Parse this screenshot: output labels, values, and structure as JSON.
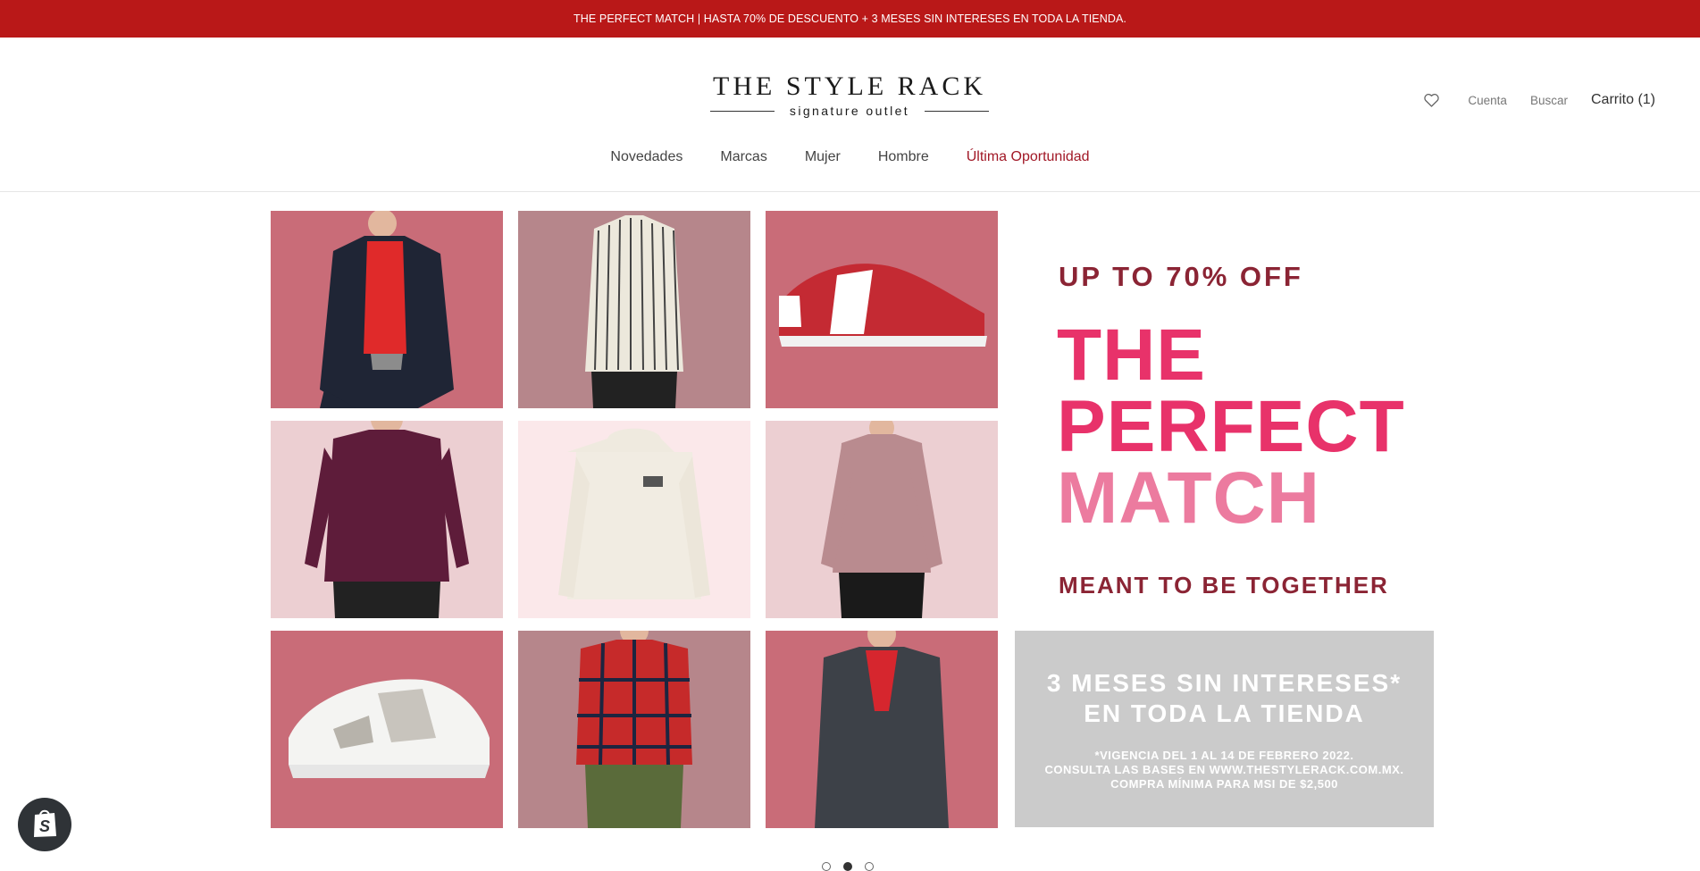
{
  "announcement": "THE PERFECT MATCH | HASTA 70% DE DESCUENTO + 3 MESES SIN INTERESES EN TODA LA TIENDA.",
  "logo": {
    "title": "THE STYLE RACK",
    "subtitle": "signature outlet"
  },
  "header": {
    "wishlist_icon": "heart-icon",
    "account_label": "Cuenta",
    "search_label": "Buscar",
    "cart_label": "Carrito (1)"
  },
  "nav": [
    {
      "label": "Novedades"
    },
    {
      "label": "Marcas"
    },
    {
      "label": "Mujer"
    },
    {
      "label": "Hombre"
    },
    {
      "label": "Última Oportunidad"
    }
  ],
  "hero": {
    "promo": {
      "upto": "UP TO 70% OFF",
      "line1": "THE",
      "line2": "PERFECT",
      "line3": "MATCH",
      "tagline": "MEANT TO BE TOGETHER"
    },
    "msi": {
      "line1": "3 MESES SIN INTERESES*",
      "line2": "EN TODA LA TIENDA",
      "fine1": "*VIGENCIA DEL 1 AL 14 DE FEBRERO 2022.",
      "fine2": "CONSULTA LAS BASES EN WWW.THESTYLERACK.COM.MX.",
      "fine3": "COMPRA MÍNIMA PARA MSI DE $2,500"
    },
    "colors": {
      "rose": "#c96c78",
      "mauve": "#b6868b",
      "pink_light": "#eccfd2",
      "pink_pale": "#fbe8ea",
      "headline": "#e8326a",
      "accent": "#8b2434"
    }
  },
  "carousel": {
    "slides": 3,
    "active": 2
  },
  "colors": {
    "announcement_bg": "#b91818",
    "sale_link": "#a11826"
  }
}
